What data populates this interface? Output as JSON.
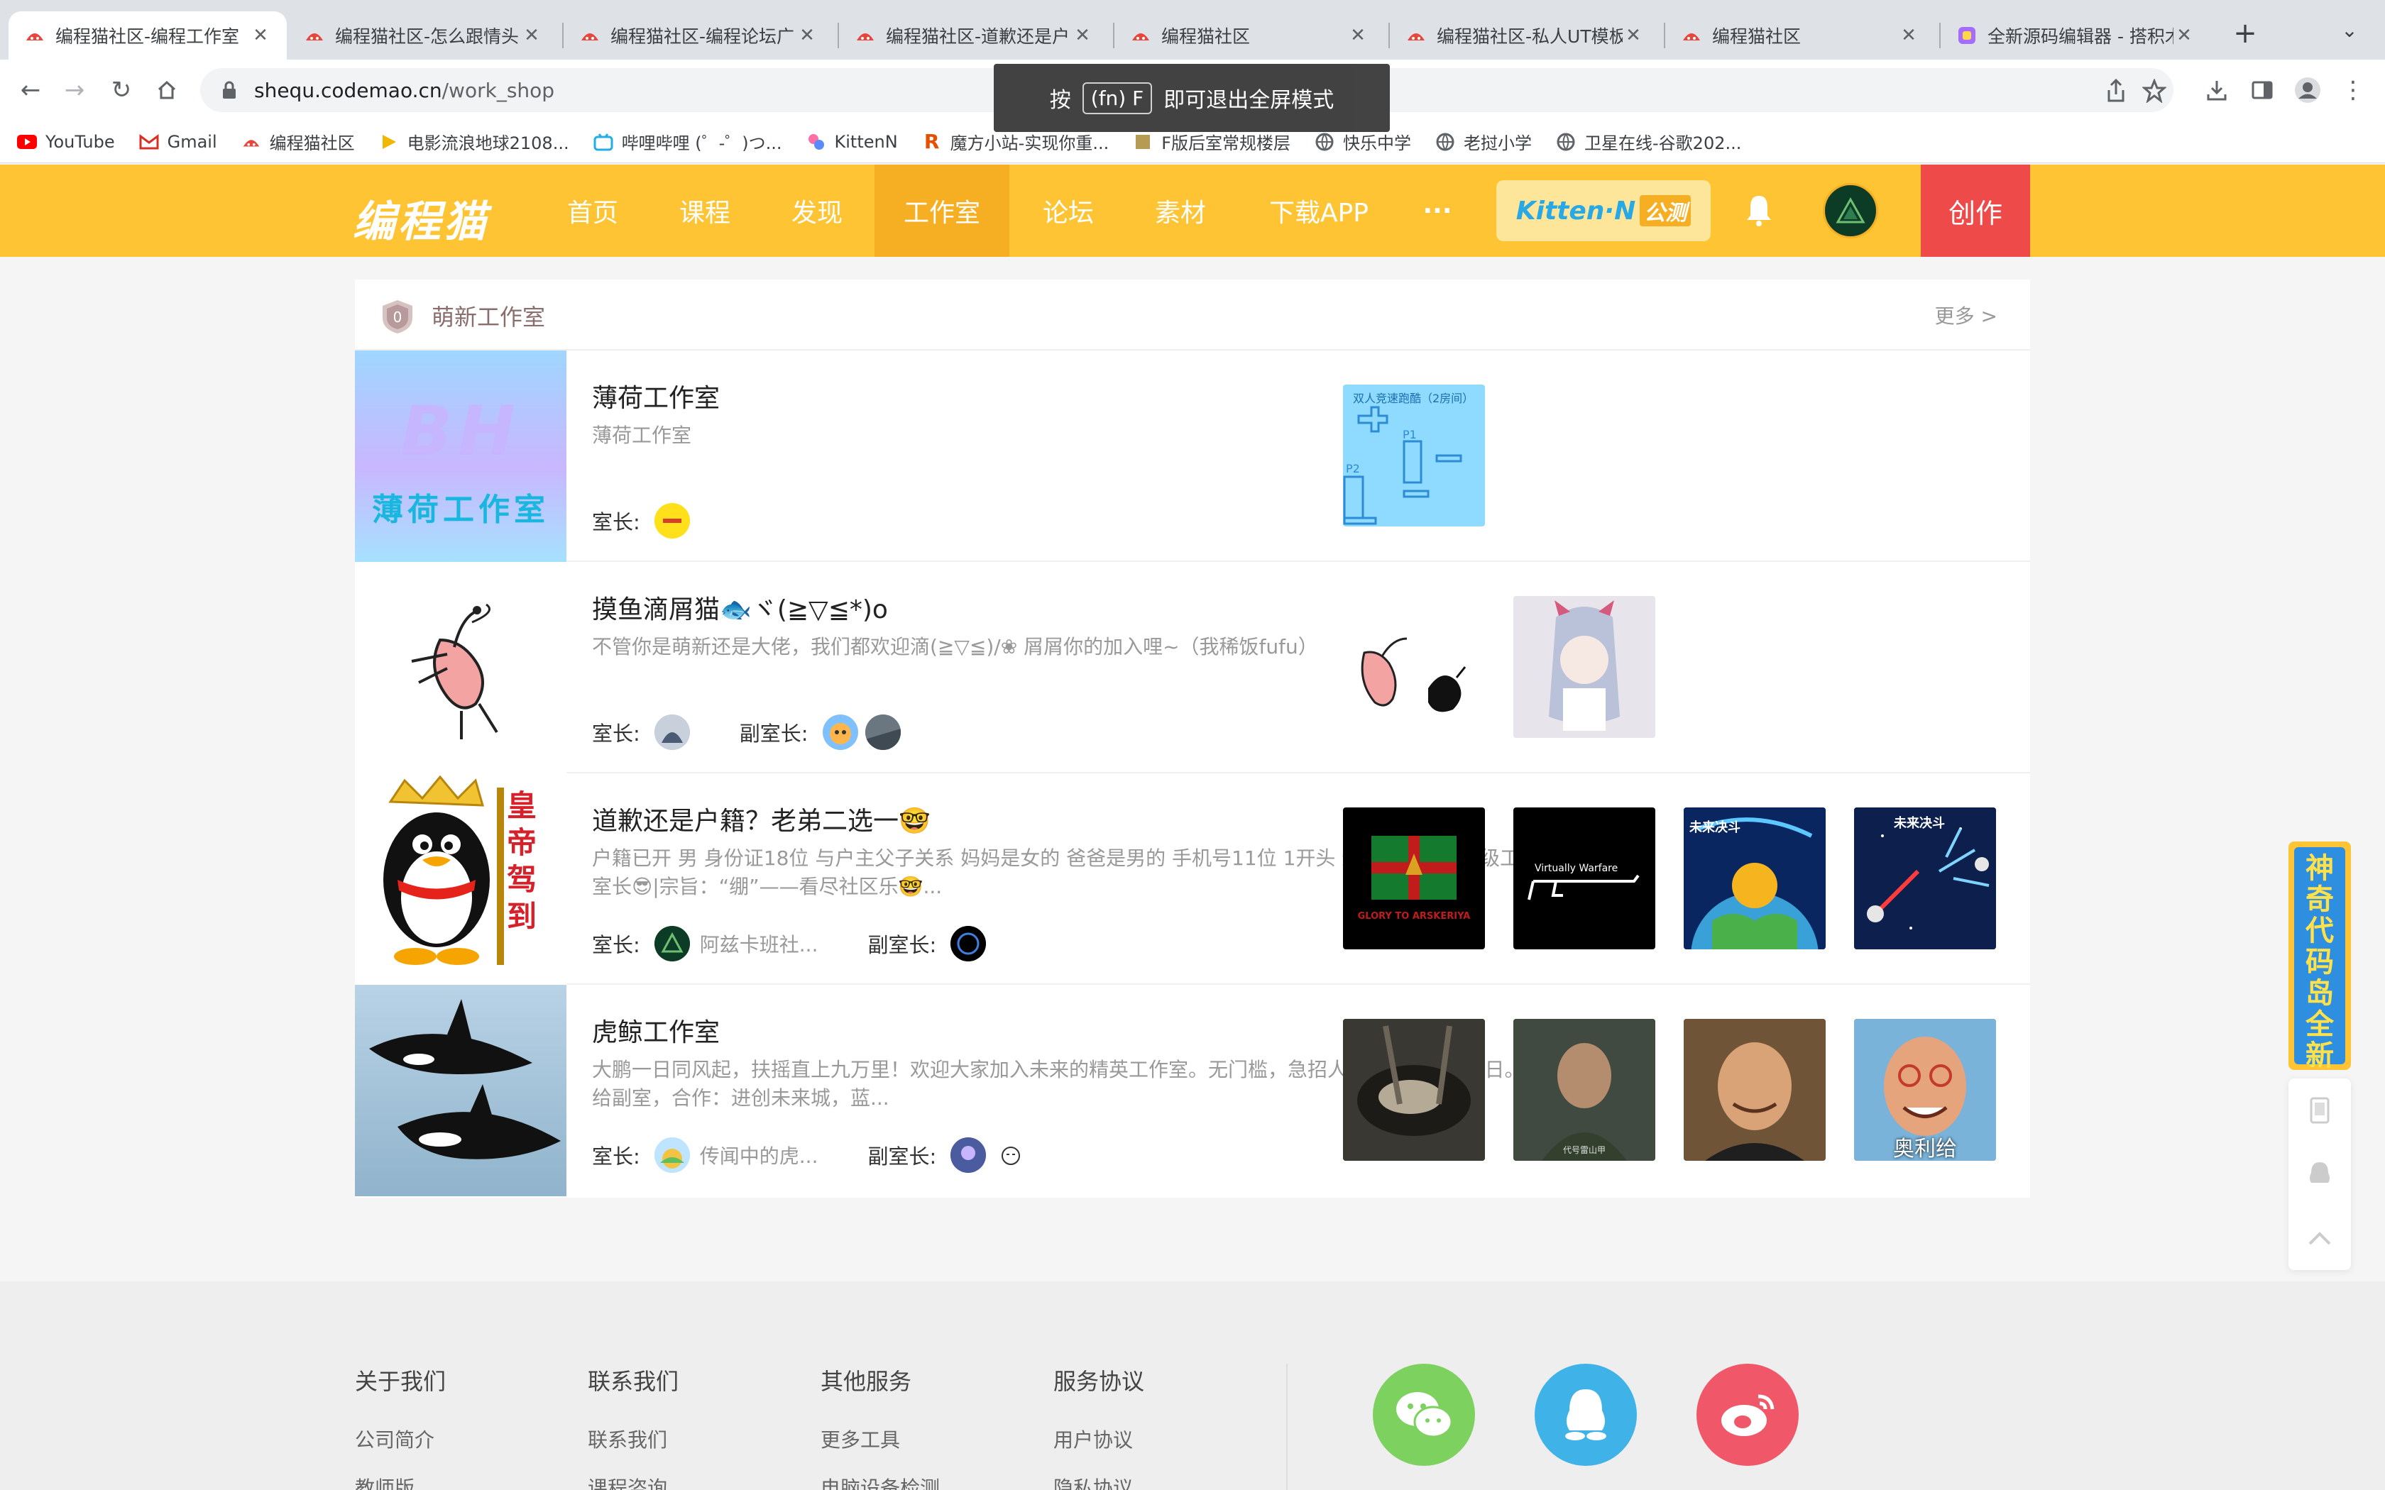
{
  "browser": {
    "tabs": [
      {
        "title": "编程猫社区-编程工作室"
      },
      {
        "title": "编程猫社区-怎么跟情头"
      },
      {
        "title": "编程猫社区-编程论坛广"
      },
      {
        "title": "编程猫社区-道歉还是户"
      },
      {
        "title": "编程猫社区"
      },
      {
        "title": "编程猫社区-私人UT模板"
      },
      {
        "title": "编程猫社区"
      },
      {
        "title": "全新源码编辑器 - 搭积木"
      }
    ],
    "url_host": "shequ.codemao.cn",
    "url_path": "/work_shop",
    "bookmarks": [
      {
        "label": "YouTube",
        "icon": "youtube-icon"
      },
      {
        "label": "Gmail",
        "icon": "gmail-icon"
      },
      {
        "label": "编程猫社区",
        "icon": "codemao-icon"
      },
      {
        "label": "电影流浪地球2108...",
        "icon": "play-icon"
      },
      {
        "label": "哔哩哔哩 (゜-゜)つ...",
        "icon": "bilibili-icon"
      },
      {
        "label": "KittenN",
        "icon": "kitten-icon"
      },
      {
        "label": "魔方小站-实现你重...",
        "icon": "r-icon"
      },
      {
        "label": "F版后室常规楼层",
        "icon": "box-icon"
      },
      {
        "label": "快乐中学",
        "icon": "globe-icon"
      },
      {
        "label": "老挝小学",
        "icon": "globe-icon"
      },
      {
        "label": "卫星在线-谷歌202...",
        "icon": "globe-icon"
      }
    ],
    "toast": {
      "pre": "按",
      "key": "(fn) F",
      "post": "即可退出全屏模式"
    }
  },
  "nav": {
    "logo": "编程猫",
    "items": [
      {
        "label": "首页"
      },
      {
        "label": "课程"
      },
      {
        "label": "发现"
      },
      {
        "label": "工作室"
      },
      {
        "label": "论坛"
      },
      {
        "label": "素材"
      },
      {
        "label": "下载APP"
      },
      {
        "label": "···"
      }
    ],
    "kitten_label": "Kitten·N",
    "kitten_badge": "公测",
    "create_label": "创作",
    "accent": "#fec433",
    "active_bg": "#f6ae22",
    "create_bg": "#ef4a4a"
  },
  "section": {
    "title": "萌新工作室",
    "more": "更多 >",
    "leader_label": "室长:",
    "deputy_label": "副室长:",
    "studios": [
      {
        "name": "薄荷工作室",
        "desc": "薄荷工作室",
        "leader_name": "",
        "cover_text": "薄荷工作室",
        "cover_letters": "BH",
        "works": [
          {
            "caption": "双人竞速跑酷（2房间）",
            "p1": "P1",
            "p2": "P2"
          }
        ]
      },
      {
        "name": "摸鱼滴屑猫🐟ヾ(≧▽≦*)o",
        "desc": "不管你是萌新还是大佬，我们都欢迎滴(≧▽≦)/❀ 屑屑你的加入哩~（我稀饭fufu）",
        "leader_name": "",
        "works": [
          {
            "caption": ""
          },
          {
            "caption": ""
          }
        ]
      },
      {
        "name": "道歉还是户籍？老弟二选一🤓",
        "desc": "户籍已开 男 身份证18位 与户主父子关系 妈妈是女的 爸爸是男的 手机号11位 1开头 道歉吧老弟 原1级工作室😎乐子人室长😎|宗旨：“绷”——看尽社区乐🤓...",
        "leader_name": "阿兹卡班社...",
        "cover_text": "皇帝驾到",
        "works": [
          {
            "caption": "GLORY TO ARSKERIYA"
          },
          {
            "caption": "Virtually Warfare"
          },
          {
            "caption": "未来决斗"
          },
          {
            "caption": "未来决斗"
          }
        ]
      },
      {
        "name": "虎鲸工作室",
        "desc": "大鹏一日同风起，扶摇直上九万里！欢迎大家加入未来的精英工作室。无门槛，急招人！生日：9月10日。冲1级，加分给副室，合作：进创未来城，蓝...",
        "leader_name": "传闻中的虎...",
        "works": [
          {
            "caption": ""
          },
          {
            "caption": "代号雷山甲"
          },
          {
            "caption": ""
          },
          {
            "caption": "奥利给"
          }
        ]
      }
    ]
  },
  "side": {
    "banner_text": "神奇代码岛全新升级"
  },
  "footer": {
    "cols": [
      {
        "heading": "关于我们",
        "links": [
          "公司简介",
          "教师版"
        ]
      },
      {
        "heading": "联系我们",
        "links": [
          "联系我们",
          "课程咨询"
        ]
      },
      {
        "heading": "其他服务",
        "links": [
          "更多工具",
          "电脑设备检测"
        ]
      },
      {
        "heading": "服务协议",
        "links": [
          "用户协议",
          "隐私协议"
        ]
      }
    ],
    "social": [
      {
        "icon": "wechat-icon",
        "color": "#7dd25f"
      },
      {
        "icon": "qq-icon",
        "color": "#3fb3e8"
      },
      {
        "icon": "weibo-icon",
        "color": "#f0586a"
      }
    ]
  }
}
